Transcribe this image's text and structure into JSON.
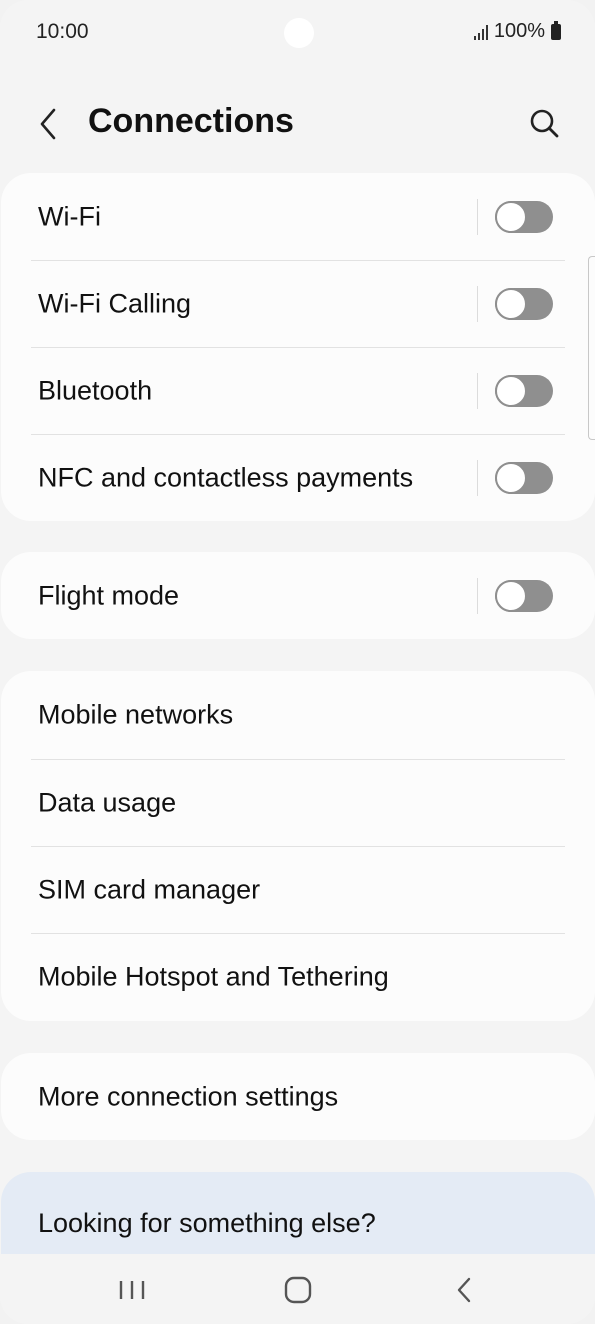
{
  "status_bar": {
    "time": "10:00",
    "battery": "100%"
  },
  "header": {
    "title": "Connections"
  },
  "cards": [
    {
      "rows": [
        {
          "label": "Wi-Fi",
          "toggle": true,
          "enabled": false
        },
        {
          "label": "Wi-Fi Calling",
          "toggle": true,
          "enabled": false
        },
        {
          "label": "Bluetooth",
          "toggle": true,
          "enabled": false
        },
        {
          "label": "NFC and contactless payments",
          "toggle": true,
          "enabled": false
        }
      ]
    },
    {
      "rows": [
        {
          "label": "Flight mode",
          "toggle": true,
          "enabled": false
        }
      ]
    },
    {
      "rows": [
        {
          "label": "Mobile networks"
        },
        {
          "label": "Data usage"
        },
        {
          "label": "SIM card manager"
        },
        {
          "label": "Mobile Hotspot and Tethering"
        }
      ]
    },
    {
      "rows": [
        {
          "label": "More connection settings"
        }
      ]
    }
  ],
  "suggestions": {
    "title": "Looking for something else?"
  },
  "colors": {
    "toggle_off": "#8f8f8f",
    "card_bg": "#fcfcfc",
    "page_bg": "#f4f4f4",
    "suggest_bg": "#e4ebf5"
  }
}
